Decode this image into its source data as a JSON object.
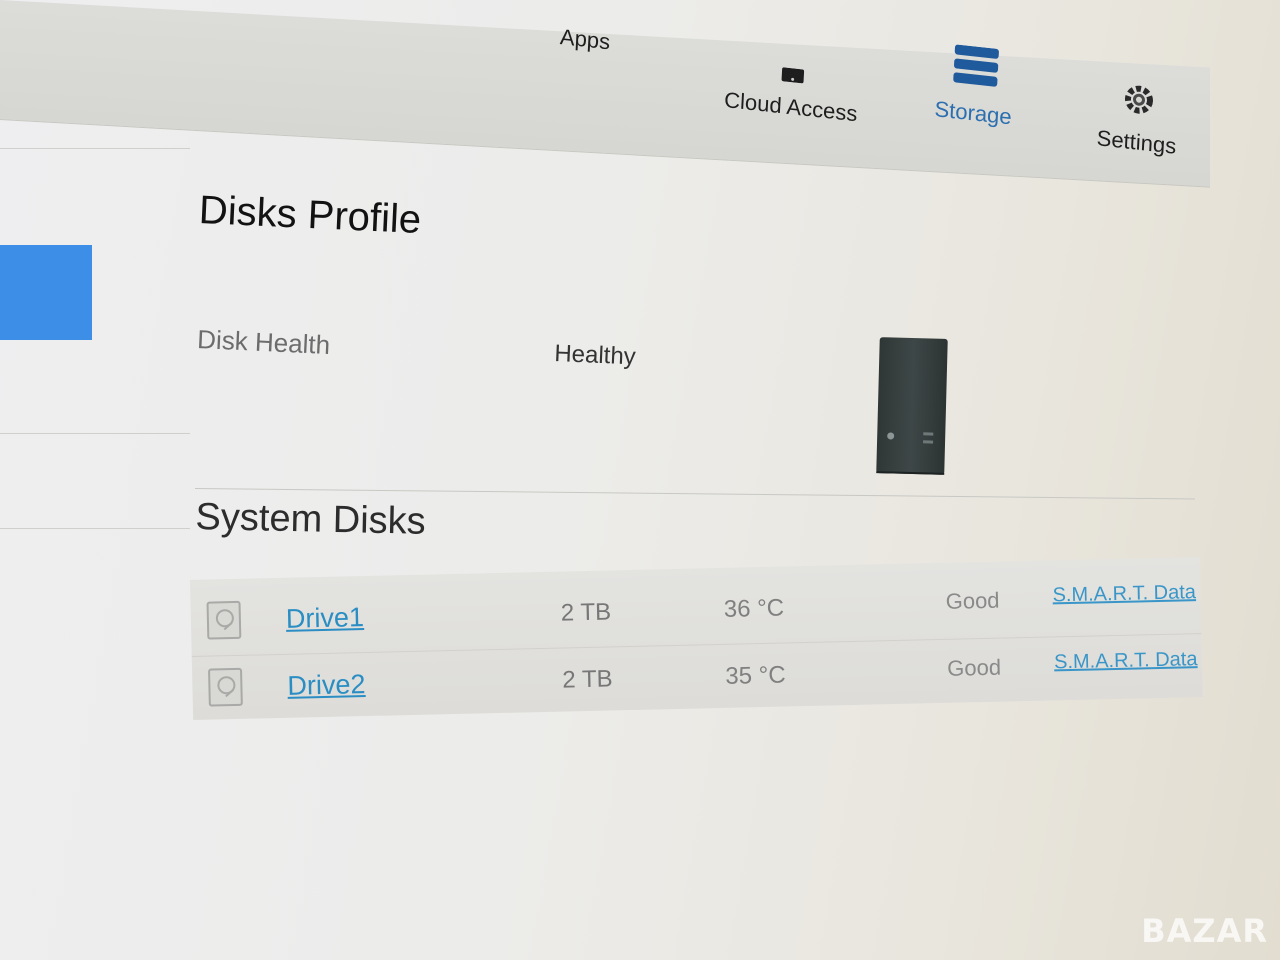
{
  "nav": {
    "items": [
      {
        "label": "Apps",
        "icon": "apps-icon"
      },
      {
        "label": "Cloud Access",
        "icon": "tablet-icon"
      },
      {
        "label": "Storage",
        "icon": "database-icon",
        "active": true
      },
      {
        "label": "Settings",
        "icon": "gear-icon"
      }
    ]
  },
  "page": {
    "title": "Disks Profile",
    "health_label": "Disk Health",
    "health_value": "Healthy",
    "section_title": "System Disks"
  },
  "disks": [
    {
      "name": "Drive1",
      "size": "2 TB",
      "temperature": "36 °C",
      "status": "Good",
      "smart_link": "S.M.A.R.T. Data"
    },
    {
      "name": "Drive2",
      "size": "2 TB",
      "temperature": "35 °C",
      "status": "Good",
      "smart_link": "S.M.A.R.T. Data"
    }
  ],
  "watermark": "BAZAR",
  "colors": {
    "accent": "#3c8ee6",
    "link": "#2a8ec4",
    "active_nav": "#2b6fb0"
  }
}
